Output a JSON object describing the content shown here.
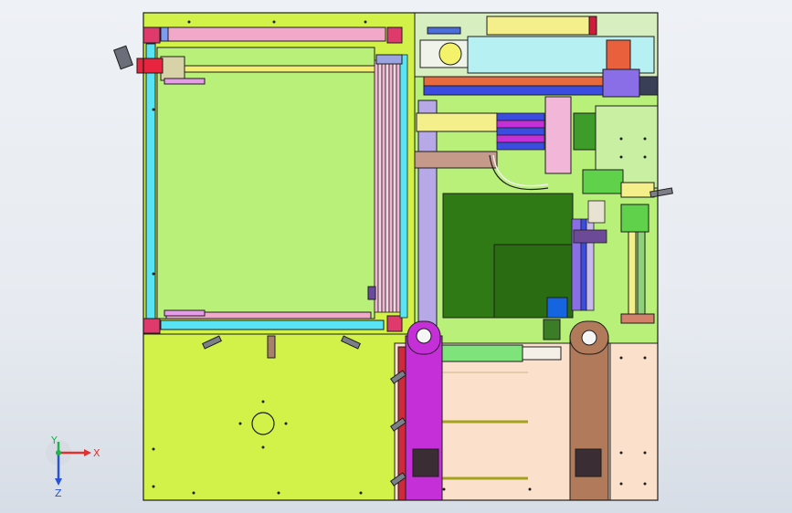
{
  "triad": {
    "x_label": "X",
    "y_label": "Y",
    "z_label": "Z"
  },
  "colors": {
    "background_top": "#eef1f5",
    "frame_fill": "#d2f24a",
    "panel_light_green": "#b9f07a",
    "cyan_rail": "#59e4f5",
    "pink_rail": "#f2a9c9",
    "magenta_block": "#c52fd8",
    "pcb_green": "#2f7a14",
    "peach_plate": "#fbe0cc",
    "brown_column": "#b07a5b",
    "blue_roller": "#3b4de0",
    "orange_rod": "#e56b3f",
    "dark_outline": "#1e1e1e"
  },
  "icons": [
    "coordinate-triad-icon"
  ]
}
